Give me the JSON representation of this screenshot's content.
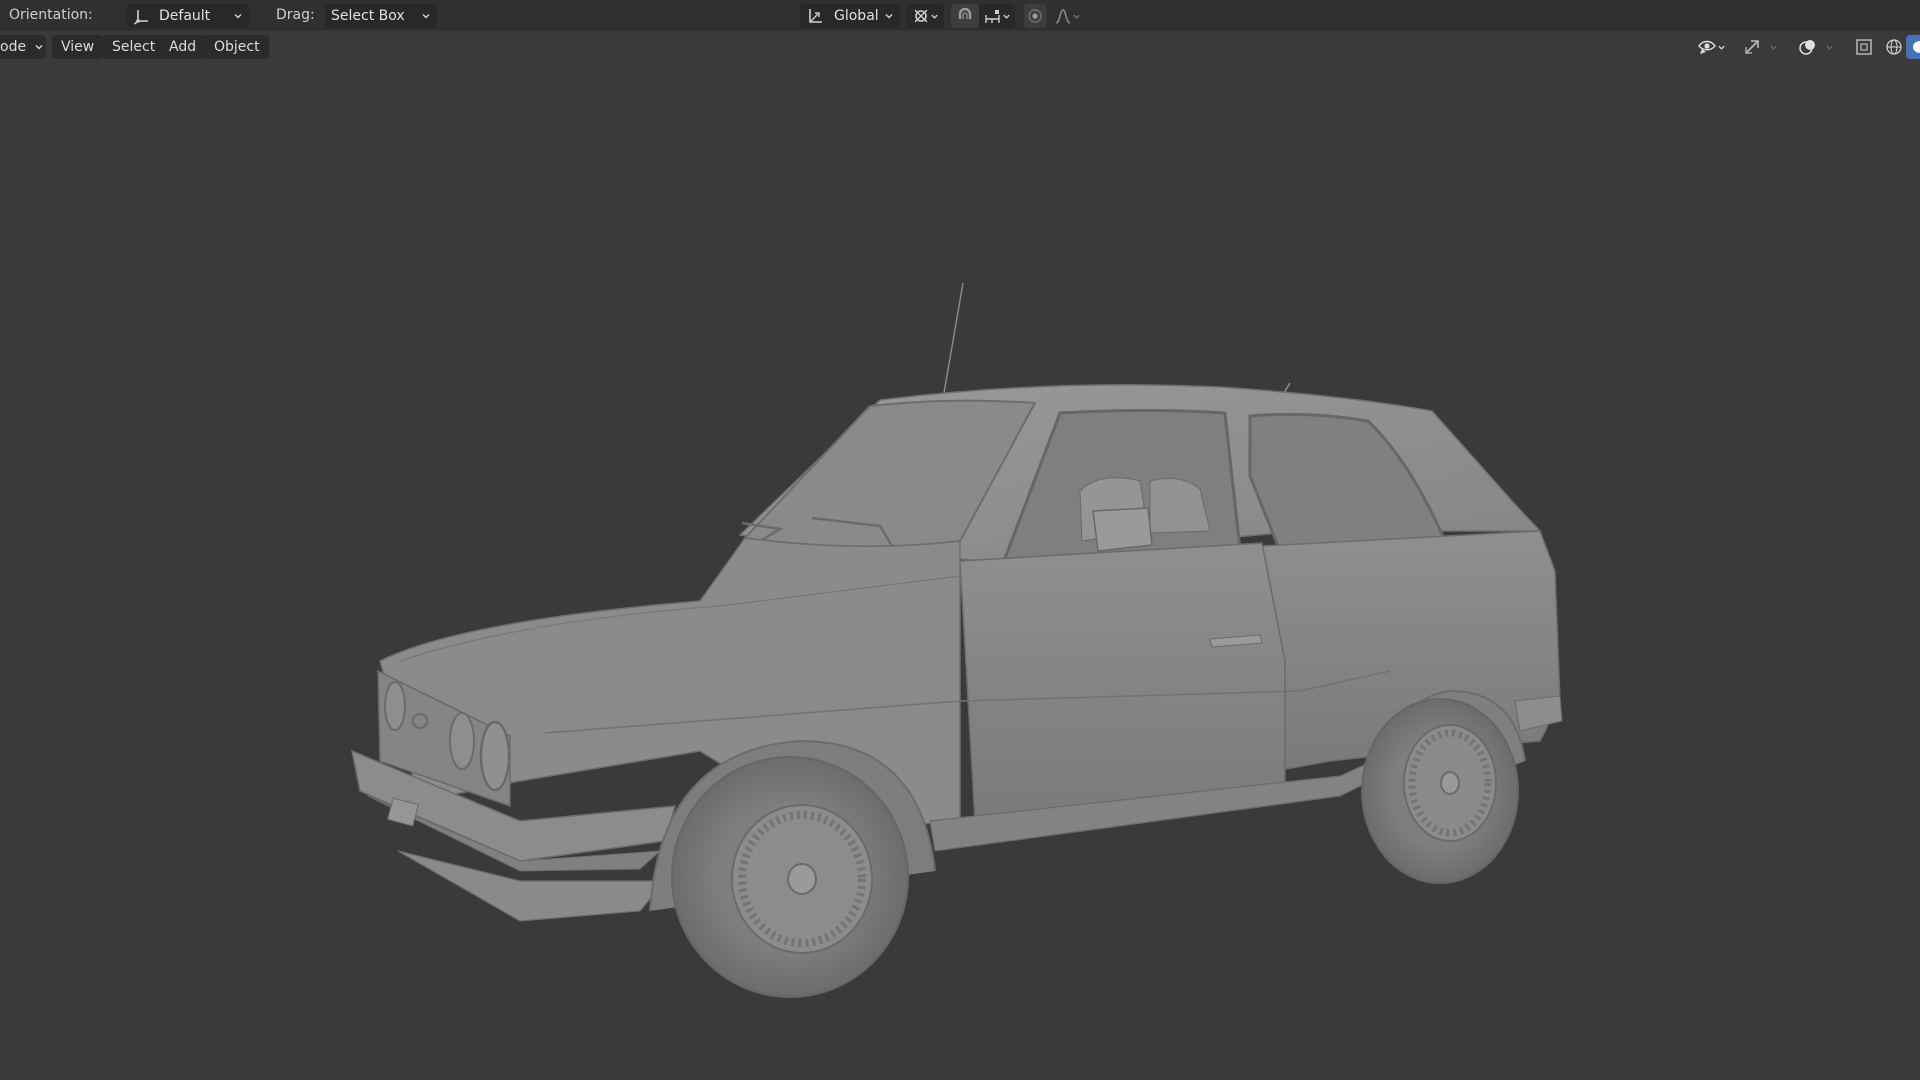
{
  "tool_header": {
    "orientation_label": "Orientation:",
    "orientation_value": "Default",
    "drag_label": "Drag:",
    "drag_value": "Select Box",
    "transform_orientation_value": "Global",
    "icons": {
      "orientation": "gizmo-axes-icon",
      "transform_orientation": "transform-axes-icon",
      "pivot": "pivot-point-icon",
      "snap": "snap-magnet-icon",
      "snap_target": "snap-increment-icon",
      "proportional": "proportional-editing-icon",
      "falloff": "falloff-curve-icon"
    }
  },
  "view_header": {
    "mode_label": "ode",
    "menus": [
      "View",
      "Select",
      "Add",
      "Object"
    ],
    "icons": {
      "visibility": "eye-visibility-icon",
      "gizmo": "gizmo-toggle-icon",
      "overlay": "overlays-icon",
      "xray": "xray-toggle-icon",
      "wireframe": "wireframe-shading-icon",
      "solid": "solid-shading-icon"
    }
  },
  "viewport": {
    "subject": "3d-car-model",
    "background_color": "#3a3a3a",
    "model_color": "#8c8c8c"
  }
}
